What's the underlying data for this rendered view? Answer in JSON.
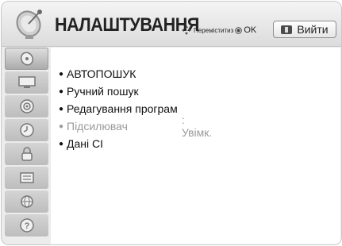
{
  "header": {
    "title": "НАЛАШТУВАННЯ",
    "hint_move": "Переміститиз",
    "hint_ok": "OK",
    "exit_label": "Вийти"
  },
  "sidebar": {
    "items": [
      {
        "icon": "satellite-dish-icon",
        "active": true
      },
      {
        "icon": "tv-screen-icon",
        "active": false
      },
      {
        "icon": "speaker-icon",
        "active": false
      },
      {
        "icon": "clock-icon",
        "active": false
      },
      {
        "icon": "lock-icon",
        "active": false
      },
      {
        "icon": "options-icon",
        "active": false
      },
      {
        "icon": "network-globe-icon",
        "active": false
      },
      {
        "icon": "help-icon",
        "active": false
      }
    ]
  },
  "menu": {
    "items": [
      {
        "label": "АВТОПОШУК",
        "value": "",
        "disabled": false
      },
      {
        "label": "Ручний пошук",
        "value": "",
        "disabled": false
      },
      {
        "label": "Редагування програм",
        "value": "",
        "disabled": false
      },
      {
        "label": "Підсилювач",
        "value": ": Увімк.",
        "disabled": true
      },
      {
        "label": "Дані CI",
        "value": "",
        "disabled": false
      }
    ]
  },
  "colors": {
    "header_bg": "#e6e6e6",
    "content_bg": "#ffffff",
    "disabled_text": "#9a9a9a",
    "accent_dark": "#4b4b4b"
  }
}
